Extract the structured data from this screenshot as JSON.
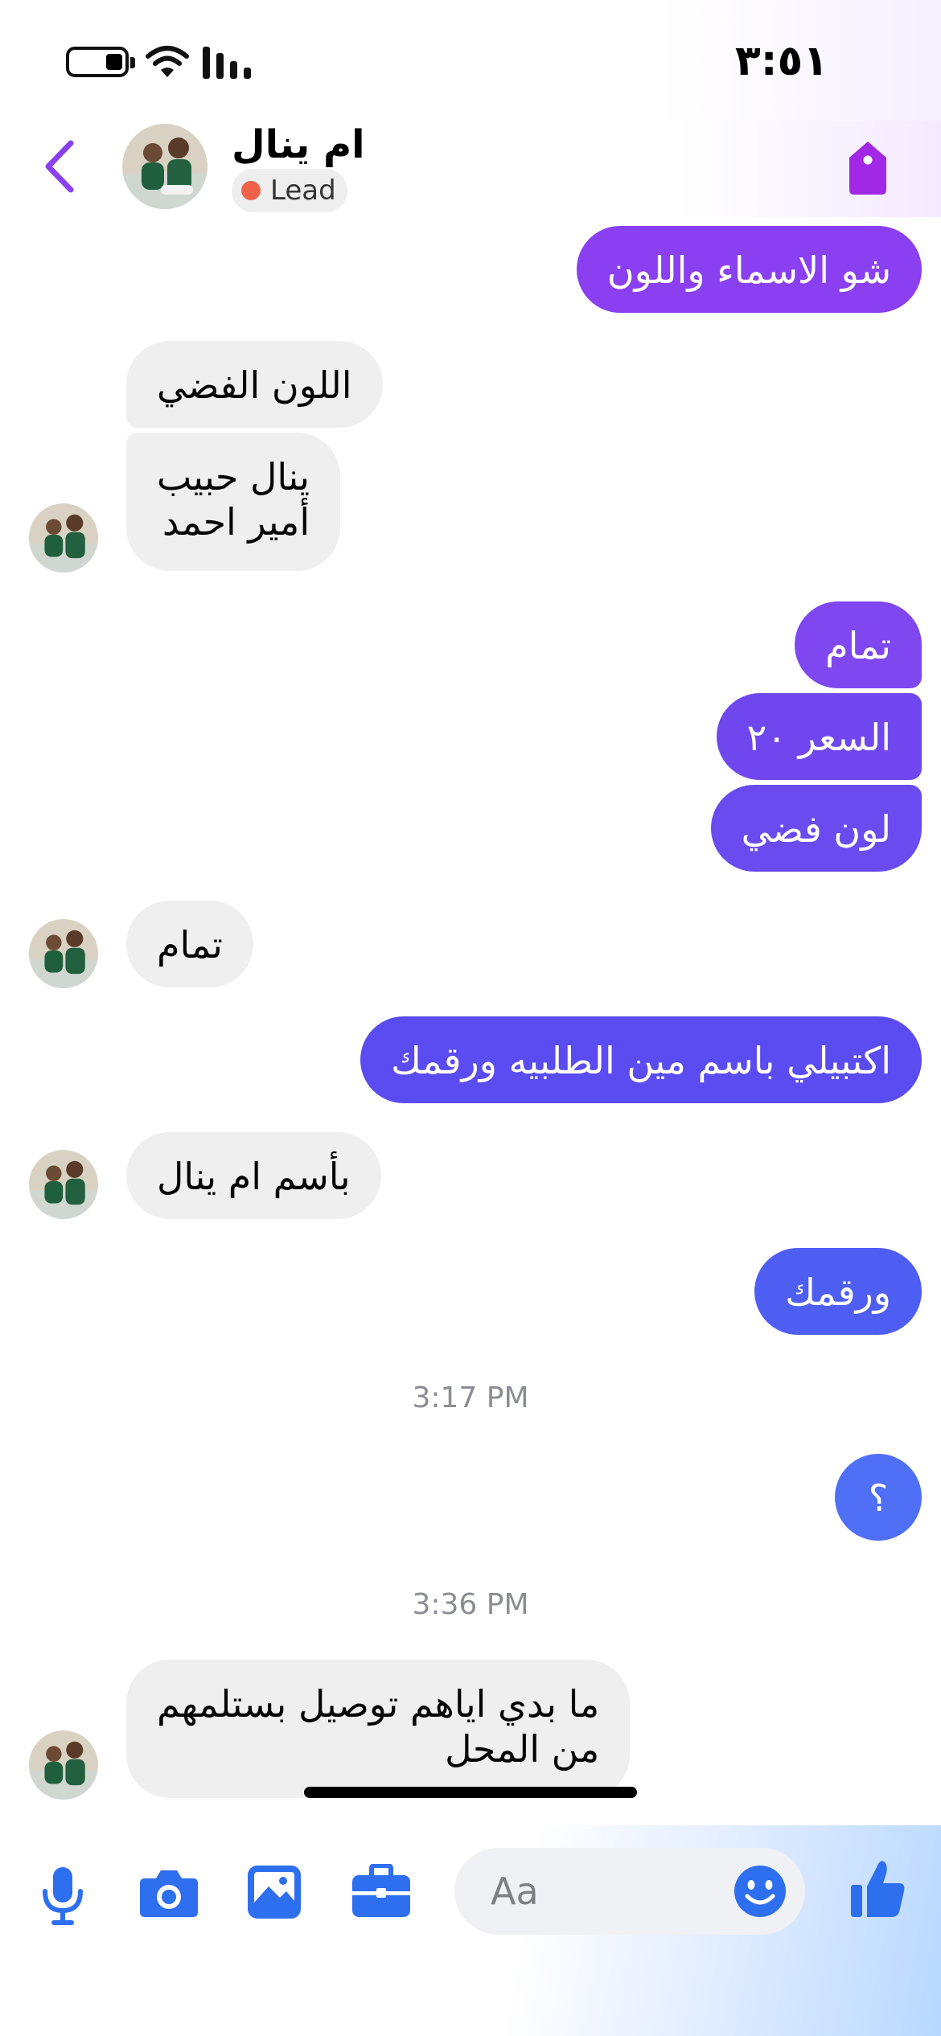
{
  "status_bar": {
    "time": "٣:٥١"
  },
  "header": {
    "contact_name": "ام ينال",
    "badge_label": "Lead"
  },
  "colors": {
    "accent": "#7b3fe4",
    "bubble_purple": "#8a3ff0",
    "bubble_indigo": "#5a4cf0",
    "bubble_blue": "#4f6ff6",
    "incoming": "#efefef",
    "composer_blue": "#2e6ff0"
  },
  "messages": [
    {
      "text": "شو الاسماء واللون"
    },
    {
      "text": "اللون الفضي"
    },
    {
      "text": "ينال حبيب"
    },
    {
      "text": "أمير احمد"
    },
    {
      "text": "تمام"
    },
    {
      "text": "السعر ٢٠"
    },
    {
      "text": "لون فضي"
    },
    {
      "text": "تمام"
    },
    {
      "text": "اكتبيلي باسم مين الطلبيه ورقمك"
    },
    {
      "text": "بأسم ام ينال"
    },
    {
      "text": "ورقمك"
    },
    {
      "text": "؟"
    },
    {
      "text": "ما بدي اياهم توصيل بستلمهم"
    },
    {
      "text": "من المحل"
    }
  ],
  "timestamps": [
    "3:17 PM",
    "3:36 PM"
  ],
  "composer": {
    "placeholder": "Aa",
    "icons": [
      "microphone-icon",
      "camera-icon",
      "image-icon",
      "briefcase-icon",
      "emoji-icon",
      "thumbs-up-icon"
    ]
  }
}
